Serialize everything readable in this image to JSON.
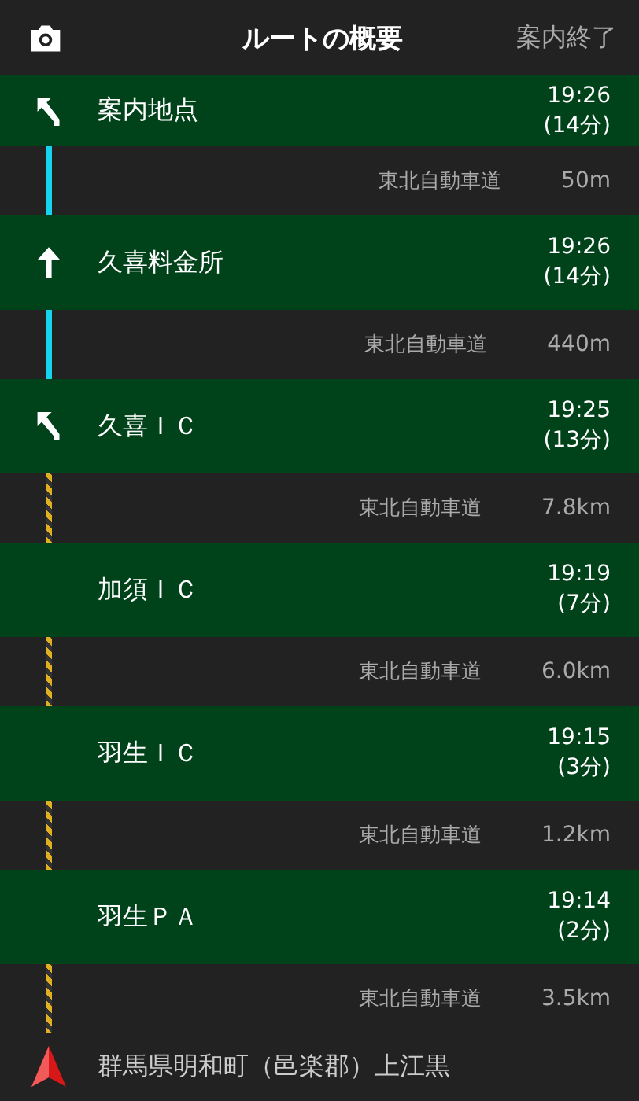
{
  "header": {
    "title": "ルートの概要",
    "end_button": "案内終了"
  },
  "items": [
    {
      "kind": "waypoint",
      "maneuver": {
        "kind": "left"
      },
      "name": "案内地点",
      "time": "19:26",
      "eta": "(14分)"
    },
    {
      "kind": "segment",
      "line": {
        "kind": "solid"
      },
      "road": "東北自動車道",
      "distance": "50m"
    },
    {
      "kind": "waypoint",
      "maneuver": {
        "kind": "straight"
      },
      "name": "久喜料金所",
      "time": "19:26",
      "eta": "(14分)"
    },
    {
      "kind": "segment",
      "line": {
        "kind": "solid"
      },
      "road": "東北自動車道",
      "distance": "440m"
    },
    {
      "kind": "waypoint",
      "maneuver": {
        "kind": "left"
      },
      "name": "久喜ＩＣ",
      "time": "19:25",
      "eta": "(13分)"
    },
    {
      "kind": "segment",
      "line": {
        "kind": "hatched"
      },
      "road": "東北自動車道",
      "distance": "7.8km"
    },
    {
      "kind": "waypoint",
      "name": "加須ＩＣ",
      "time": "19:19",
      "eta": "(7分)"
    },
    {
      "kind": "segment",
      "line": {
        "kind": "hatched"
      },
      "road": "東北自動車道",
      "distance": "6.0km"
    },
    {
      "kind": "waypoint",
      "name": "羽生ＩＣ",
      "time": "19:15",
      "eta": "(3分)"
    },
    {
      "kind": "segment",
      "line": {
        "kind": "hatched"
      },
      "road": "東北自動車道",
      "distance": "1.2km"
    },
    {
      "kind": "waypoint",
      "name": "羽生ＰＡ",
      "time": "19:14",
      "eta": "(2分)"
    },
    {
      "kind": "segment",
      "line": {
        "kind": "hatched"
      },
      "road": "東北自動車道",
      "distance": "3.5km"
    },
    {
      "kind": "destination",
      "name": "群馬県明和町（邑楽郡）上江黒"
    }
  ]
}
